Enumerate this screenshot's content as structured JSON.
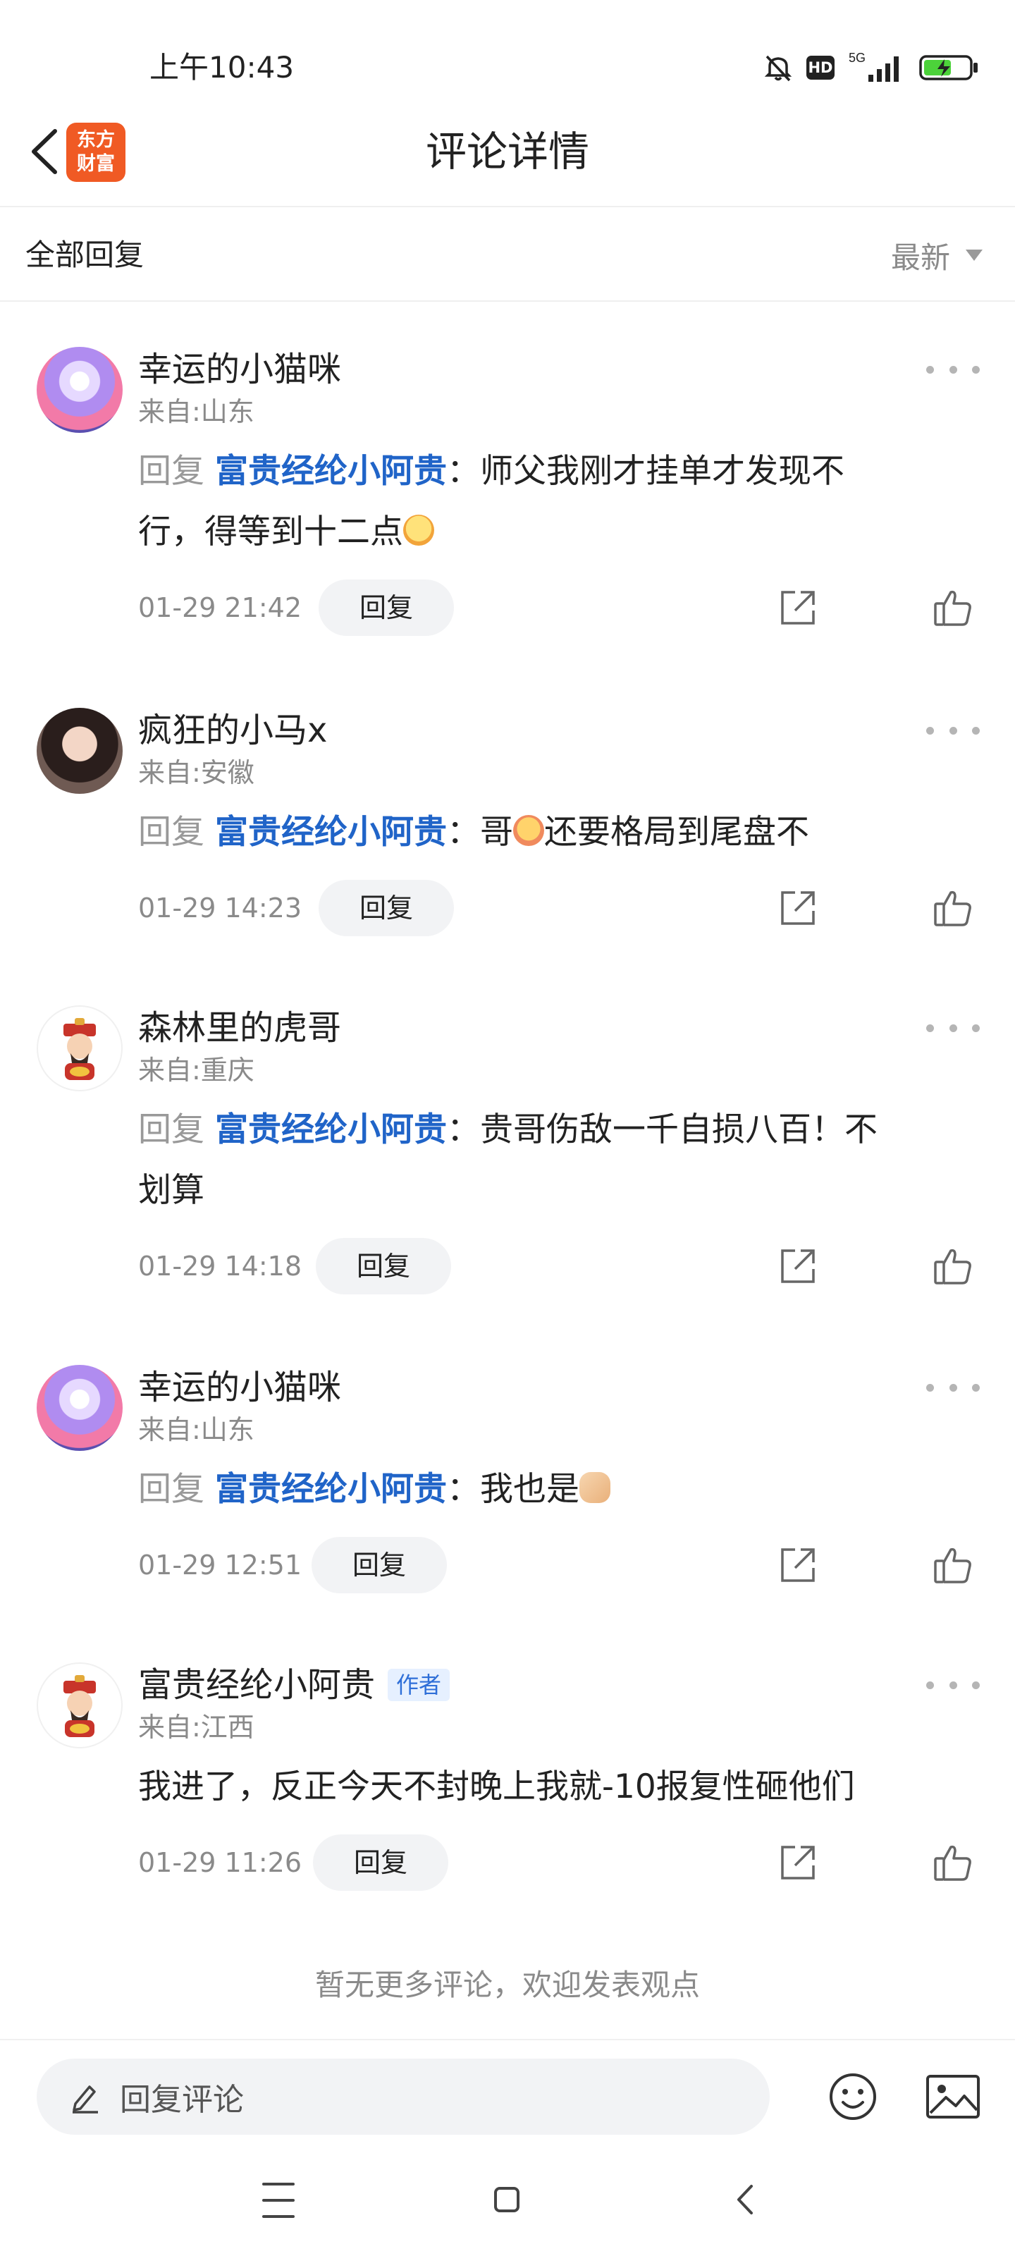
{
  "status_bar": {
    "time": "上午10:43",
    "hd": "HD",
    "network": "5G"
  },
  "header": {
    "title": "评论详情",
    "logo_line1": "东方",
    "logo_line2": "财富",
    "brand_color": "#f05a24"
  },
  "section": {
    "title": "全部回复",
    "sort_label": "最新"
  },
  "comments": [
    {
      "username": "幸运的小猫咪",
      "location": "来自:山东",
      "reply_prefix": "回复",
      "reply_target": "富贵经纶小阿贵",
      "text_line1": "：师父我刚才挂单才发现不",
      "text_line2": "行，得等到十二点",
      "emoji": "grinning-face",
      "time": "01-29 21:42",
      "reply_button": "回复"
    },
    {
      "username": "疯狂的小马x",
      "location": "来自:安徽",
      "reply_prefix": "回复",
      "reply_target": "富贵经纶小阿贵",
      "text_before_emoji": "：哥",
      "text_after_emoji": "还要格局到尾盘不",
      "emoji": "pleading-face",
      "time": "01-29 14:23",
      "reply_button": "回复"
    },
    {
      "username": "森林里的虎哥",
      "location": "来自:重庆",
      "reply_prefix": "回复",
      "reply_target": "富贵经纶小阿贵",
      "text_line1": "：贵哥伤敌一千自损八百！不",
      "text_line2": "划算",
      "time": "01-29 14:18",
      "reply_button": "回复"
    },
    {
      "username": "幸运的小猫咪",
      "location": "来自:山东",
      "reply_prefix": "回复",
      "reply_target": "富贵经纶小阿贵",
      "text_line1": "：我也是",
      "emoji": "handshake",
      "time": "01-29 12:51",
      "reply_button": "回复"
    },
    {
      "username": "富贵经纶小阿贵",
      "author_tag": "作者",
      "location": "来自:江西",
      "text_line1": "我进了，反正今天不封晚上我就-10报复性砸他们",
      "time": "01-29 11:26",
      "reply_button": "回复"
    }
  ],
  "footer": {
    "no_more_text": "暂无更多评论，欢迎发表观点",
    "reply_placeholder": "回复评论"
  },
  "colors": {
    "link_blue": "#2064c8",
    "muted_gray": "#8a8a8a",
    "author_tag_bg": "#e6f0ff"
  }
}
